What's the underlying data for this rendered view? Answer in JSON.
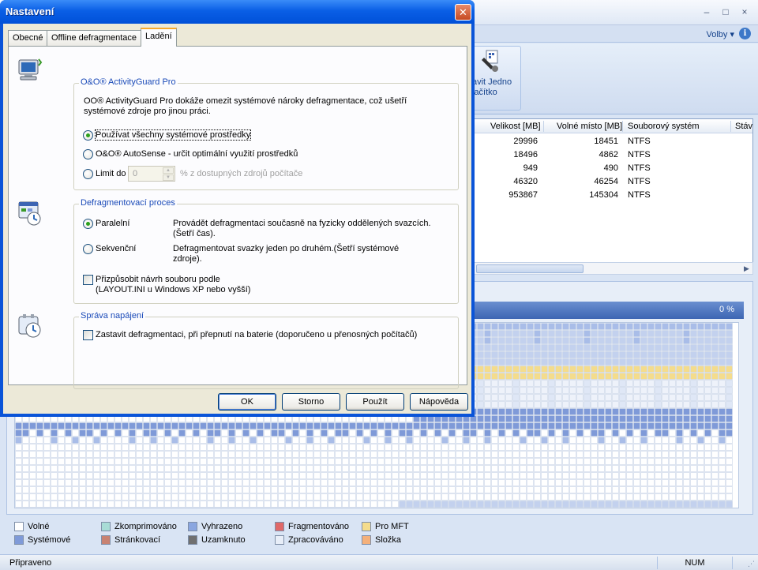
{
  "app": {
    "window_controls": {
      "minimize": "–",
      "restore": "□",
      "close": "×"
    },
    "options_label": "Volby ▾",
    "help_icon_glyph": "i",
    "oneclick_label": "avit Jedno\nlačítko",
    "volumes_table": {
      "columns": [
        "Velikost [MB]",
        "Volné místo [MB]",
        "Souborový systém",
        "Stáv"
      ],
      "rows": [
        {
          "size": "29996",
          "free": "18451",
          "fs": "NTFS"
        },
        {
          "size": "18496",
          "free": "4862",
          "fs": "NTFS"
        },
        {
          "size": "949",
          "free": "490",
          "fs": "NTFS"
        },
        {
          "size": "46320",
          "free": "46254",
          "fs": "NTFS"
        },
        {
          "size": "953867",
          "free": "145304",
          "fs": "NTFS"
        }
      ]
    },
    "map": {
      "progress_label": "0 %"
    },
    "legend": [
      {
        "label": "Volné",
        "color": "#ffffff"
      },
      {
        "label": "Zkomprimováno",
        "color": "#a8dcd6"
      },
      {
        "label": "Vyhrazeno",
        "color": "#8aa6e0"
      },
      {
        "label": "Fragmentováno",
        "color": "#e06868"
      },
      {
        "label": "Pro MFT",
        "color": "#f4dc8c"
      },
      {
        "label": "Systémové",
        "color": "#7f9ad8"
      },
      {
        "label": "Stránkovací",
        "color": "#c88272"
      },
      {
        "label": "Uzamknuto",
        "color": "#707070"
      },
      {
        "label": "Zpracováváno",
        "color": "#e8eef8"
      },
      {
        "label": "Složka",
        "color": "#f4b07a"
      }
    ],
    "status": {
      "text": "Připraveno",
      "num": "NUM"
    }
  },
  "dialog": {
    "title": "Nastavení",
    "close_glyph": "✕",
    "tabs": [
      "Obecné",
      "Offline defragmentace",
      "Ladění"
    ],
    "activity_guard": {
      "title": "O&O® ActivityGuard Pro",
      "description_line1": "OO® ActivityGuard Pro dokáže omezit systémové nároky defragmentace, což ušetří",
      "description_line2": "systémové zdroje pro jinou práci.",
      "option_all": "Používat všechny systémové prostředky",
      "option_autosense": "O&O® AutoSense - určit optimální využití prostředků",
      "option_limit": "Limit do",
      "limit_value": "0",
      "limit_suffix": "% z dostupných zdrojů počítače"
    },
    "defrag_process": {
      "title": "Defragmentovací proces",
      "parallel_label": "Paralelní",
      "parallel_desc_line1": "Provádět defragmentaci současně na fyzicky oddělených svazcích.",
      "parallel_desc_line2": "(Šetří čas).",
      "sequential_label": "Sekvenční",
      "sequential_desc_line1": "Defragmentovat svazky jeden po druhém.(Šetří systémové",
      "sequential_desc_line2": "zdroje).",
      "layout_line1": "Přizpůsobit návrh souboru podle",
      "layout_line2": "(LAYOUT.INI u Windows XP nebo vyšší)"
    },
    "power": {
      "title": "Správa napájení",
      "stop_on_battery": "Zastavit defragmentaci, při přepnutí na baterie (doporučeno u přenosných počítačů)"
    },
    "buttons": {
      "ok": "OK",
      "cancel": "Storno",
      "apply": "Použít",
      "help": "Nápověda"
    }
  }
}
